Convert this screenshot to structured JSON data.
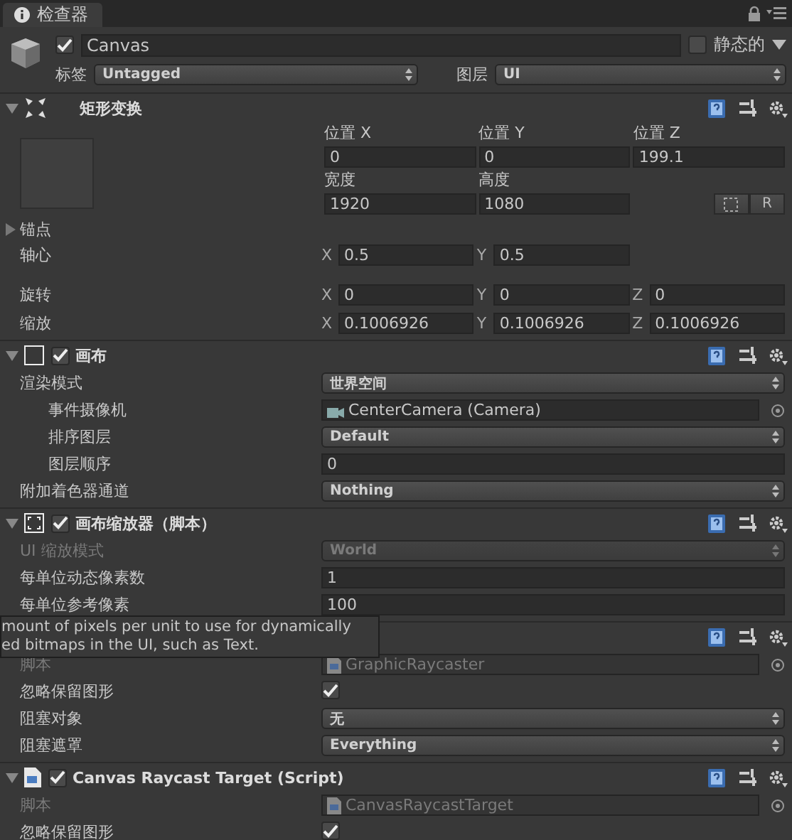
{
  "tab": {
    "title": "检查器"
  },
  "object": {
    "active": true,
    "name": "Canvas",
    "static": false,
    "static_label": "静态的",
    "tag_label": "标签",
    "tag": "Untagged",
    "layer_label": "图层",
    "layer": "UI"
  },
  "rect": {
    "title": "矩形变换",
    "expanded": true,
    "fields": [
      {
        "label": "位置 X",
        "value": "0"
      },
      {
        "label": "位置 Y",
        "value": "0"
      },
      {
        "label": "位置 Z",
        "value": "199.1"
      },
      {
        "label": "宽度",
        "value": "1920"
      },
      {
        "label": "高度",
        "value": "1080"
      }
    ],
    "button": "R",
    "anchors": {
      "label": "锚点",
      "expanded": false
    },
    "rows": [
      {
        "label": "轴心",
        "axes": [
          {
            "axis": "X",
            "value": "0.5"
          },
          {
            "axis": "Y",
            "value": "0.5"
          }
        ]
      },
      {
        "label": "旋转",
        "axes": [
          {
            "axis": "X",
            "value": "0"
          },
          {
            "axis": "Y",
            "value": "0"
          },
          {
            "axis": "Z",
            "value": "0"
          }
        ]
      },
      {
        "label": "缩放",
        "axes": [
          {
            "axis": "X",
            "value": "0.1006926"
          },
          {
            "axis": "Y",
            "value": "0.1006926"
          },
          {
            "axis": "Z",
            "value": "0.1006926"
          }
        ]
      }
    ]
  },
  "components": [
    {
      "kind": "canvas",
      "title": "画布",
      "enabled": true,
      "expanded": true,
      "rows": [
        {
          "kind": "dropdown",
          "label": "渲染模式",
          "value": "世界空间",
          "disabled": false,
          "children": [
            {
              "kind": "object",
              "label": "事件摄像机",
              "value": "CenterCamera (Camera)",
              "disabled": false
            },
            {
              "kind": "dropdown",
              "label": "排序图层",
              "value": "Default",
              "disabled": false
            },
            {
              "kind": "field",
              "label": "图层顺序",
              "value": "0",
              "disabled": false
            }
          ]
        },
        {
          "kind": "dropdown",
          "label": "附加着色器通道",
          "value": "Nothing",
          "disabled": false
        }
      ]
    },
    {
      "kind": "scaler",
      "title": "画布缩放器（脚本）",
      "enabled": true,
      "expanded": true,
      "rows": [
        {
          "kind": "dropdown",
          "label": "UI 缩放模式",
          "value": "World",
          "disabled": true
        },
        {
          "kind": "field",
          "label": "每单位动态像素数",
          "value": "1",
          "disabled": false
        },
        {
          "kind": "field",
          "label": "每单位参考像素",
          "value": "100",
          "disabled": false
        }
      ]
    },
    {
      "kind": "hidden",
      "rows": [
        {
          "kind": "script",
          "label": "脚本",
          "value": "GraphicRaycaster",
          "disabled": true
        },
        {
          "kind": "checkbox",
          "label": "忽略保留图形",
          "checked": true,
          "disabled": false
        },
        {
          "kind": "dropdown",
          "label": "阻塞对象",
          "value": "无",
          "disabled": false
        },
        {
          "kind": "dropdown",
          "label": "阻塞遮罩",
          "value": "Everything",
          "disabled": false
        }
      ]
    },
    {
      "kind": "script",
      "title": "Canvas Raycast Target (Script)",
      "enabled": true,
      "expanded": true,
      "rows": [
        {
          "kind": "script",
          "label": "脚本",
          "value": "CanvasRaycastTarget",
          "disabled": true
        },
        {
          "kind": "checkbox",
          "label": "忽略保留图形",
          "checked": true,
          "disabled": false
        }
      ]
    }
  ],
  "tooltip": {
    "lines": [
      "mount of pixels per unit to use for dynamically",
      "ed bitmaps in the UI, such as Text."
    ]
  }
}
